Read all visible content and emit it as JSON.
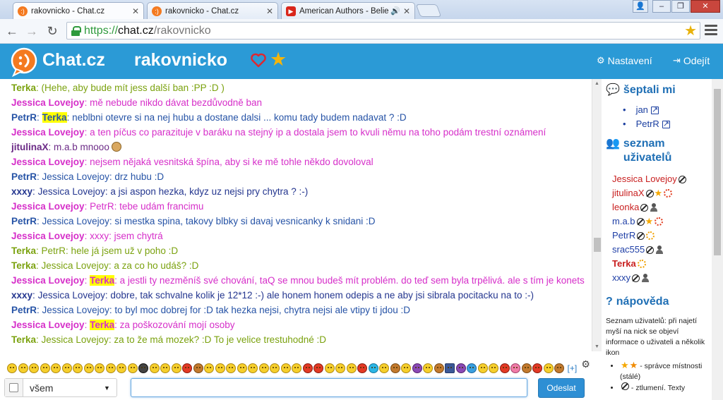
{
  "browser": {
    "tabs": [
      {
        "title": "rakovnicko - Chat.cz",
        "active": true
      },
      {
        "title": "rakovnicko - Chat.cz",
        "active": false
      },
      {
        "title": "American Authors - Believ",
        "active": false
      }
    ],
    "url_scheme": "https://",
    "url_host": "chat.cz",
    "url_path": "/rakovnicko"
  },
  "header": {
    "brand": "Chat.cz",
    "room": "rakovnicko",
    "settings_label": "Nastavení",
    "logout_label": "Odejít",
    "accent": "#2b9ad6"
  },
  "messages": [
    {
      "nick": "Terka",
      "color": "terka",
      "text": "(Hehe, aby bude mít jess další ban :PP :D )"
    },
    {
      "nick": "Jessica Lovejoy",
      "color": "jess",
      "text": "mě nebude nikdo dávat bezdůvodně ban"
    },
    {
      "nick": "PetrR",
      "color": "petr",
      "highlight": "Terka",
      "text": "neblbni otevre si na nej hubu a dostane dalsi ... komu tady budem nadavat ? :D"
    },
    {
      "nick": "Jessica Lovejoy",
      "color": "jess",
      "text": "a ten píčus co parazituje v baráku na stejný ip a dostala jsem to kvuli němu na toho podám trestní oznámení"
    },
    {
      "nick": "jitulinaX",
      "color": "jitu",
      "text": "m.a.b mnooo",
      "icon": "mascot-emoticon"
    },
    {
      "nick": "Jessica Lovejoy",
      "color": "jess",
      "text": "nejsem nějaká vesnitská špína, aby si ke mě tohle někdo dovoloval"
    },
    {
      "nick": "PetrR",
      "color": "petr",
      "text": "Jessica Lovejoy: drz hubu :D"
    },
    {
      "nick": "xxxy",
      "color": "xxxy",
      "text": "Jessica Lovejoy: a jsi aspon hezka, kdyz uz nejsi pry chytra ? :-)"
    },
    {
      "nick": "Jessica Lovejoy",
      "color": "jess",
      "text": "PetrR: tebe udám francimu"
    },
    {
      "nick": "PetrR",
      "color": "petr",
      "text": "Jessica Lovejoy: si mestka spina, takovy blbky si davaj vesnicanky k snidani :D"
    },
    {
      "nick": "Jessica Lovejoy",
      "color": "jess",
      "text": "xxxy: jsem chytrá"
    },
    {
      "nick": "Terka",
      "color": "terka",
      "text": "PetrR: hele já jsem už v poho :D"
    },
    {
      "nick": "Terka",
      "color": "terka",
      "text": "Jessica Lovejoy: a za co ho udáš? :D"
    },
    {
      "nick": "Jessica Lovejoy",
      "color": "jess",
      "highlight": "Terka",
      "text": "a jestli ty nezměníš své chování, taQ se mnou budeš mít problém. do teď sem byla trpělivá. ale s tím je konets"
    },
    {
      "nick": "xxxy",
      "color": "xxxy",
      "text": "Jessica Lovejoy: dobre, tak schvalne kolik je 12*12 :-) ale honem honem odepis a ne aby jsi sibrala pocitacku na to :-)"
    },
    {
      "nick": "PetrR",
      "color": "petr",
      "text": "Jessica Lovejoy: to byl moc dobrej for :D tak hezka nejsi, chytra nejsi ale vtipy ti jdou :D"
    },
    {
      "nick": "Jessica Lovejoy",
      "color": "jess",
      "highlight": "Terka",
      "text": "za poškozování mojí osoby"
    },
    {
      "nick": "Terka",
      "color": "terka",
      "text": "Jessica Lovejoy: za to že má mozek? :D To je velice trestuhodné :D"
    }
  ],
  "sidebar": {
    "whisper_title": "šeptali mi",
    "whispers": [
      "jan",
      "PetrR"
    ],
    "users_title_line1": "seznam",
    "users_title_line2": "uživatelů",
    "users": [
      {
        "name": "Jessica Lovejoy",
        "color": "#c81e1e",
        "bold": false,
        "icons": [
          "ban"
        ]
      },
      {
        "name": "jitulinaX",
        "color": "#c81e1e",
        "bold": false,
        "icons": [
          "ban",
          "star",
          "sun-red"
        ]
      },
      {
        "name": "leonka",
        "color": "#c81e1e",
        "bold": false,
        "icons": [
          "ban",
          "person"
        ]
      },
      {
        "name": "m.a.b",
        "color": "#1f3fa6",
        "bold": false,
        "icons": [
          "ban",
          "star",
          "sun-red"
        ]
      },
      {
        "name": "PetrR",
        "color": "#1f3fa6",
        "bold": false,
        "icons": [
          "ban",
          "sun"
        ]
      },
      {
        "name": "srac555",
        "color": "#1f3fa6",
        "bold": false,
        "icons": [
          "ban",
          "person"
        ]
      },
      {
        "name": "Terka",
        "color": "#c81e1e",
        "bold": true,
        "icons": [
          "sun"
        ]
      },
      {
        "name": "xxxy",
        "color": "#1f3fa6",
        "bold": false,
        "icons": [
          "ban",
          "person"
        ]
      }
    ],
    "help_title": "nápověda",
    "help_text": "Seznam uživatelů: při najetí myší na nick se objeví informace o uživateli a několik ikon",
    "help_items": [
      "- správce místnosti (stálé)",
      "- ztlumení. Texty"
    ]
  },
  "composer": {
    "scope_value": "všem",
    "message_value": "",
    "send_label": "Odeslat",
    "more_emoji_label": "[+]"
  }
}
